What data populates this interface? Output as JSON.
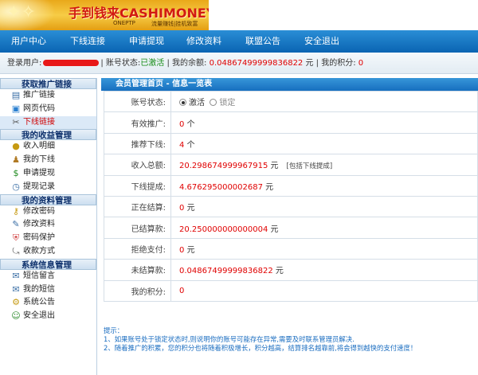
{
  "banner": {
    "title": "手到钱来CASHIMONEY!",
    "subtitle_left": "ONEPTP",
    "subtitle_right": "流量赚钱|挂机致富"
  },
  "nav": {
    "items": [
      "用户中心",
      "下线连接",
      "申请提现",
      "修改资料",
      "联盟公告",
      "安全退出"
    ]
  },
  "userbar": {
    "login_label": "登录用户:",
    "status_label": "| 账号状态:",
    "status_value": "已激活",
    "balance_label": "| 我的余额:",
    "balance_value": "0.04867499999836822",
    "balance_unit": "元",
    "points_label": "| 我的积分:",
    "points_value": "0"
  },
  "sidebar": {
    "groups": [
      {
        "title": "获取推广链接",
        "items": [
          "推广链接",
          "网页代码",
          "下线链接"
        ]
      },
      {
        "title": "我的收益管理",
        "items": [
          "收入明细",
          "我的下线",
          "申请提现",
          "提现记录"
        ]
      },
      {
        "title": "我的资料管理",
        "items": [
          "修改密码",
          "修改资料",
          "密码保护",
          "收款方式"
        ]
      },
      {
        "title": "系统信息管理",
        "items": [
          "短信留言",
          "我的短信",
          "系统公告",
          "安全退出"
        ]
      }
    ],
    "active_item": "下线链接"
  },
  "main": {
    "header": "会员管理首页 - 信息一览表",
    "rows": {
      "status": {
        "label": "账号状态:",
        "option_on": "激活",
        "option_off": "锁定"
      },
      "active_referrals": {
        "label": "有效推广:",
        "value": "0",
        "unit": "个"
      },
      "referral_downlines": {
        "label": "推荐下线:",
        "value": "4",
        "unit": "个"
      },
      "total_income": {
        "label": "收入总额:",
        "value": "20.298674999967915",
        "unit": "元",
        "note": "[包括下线提成]"
      },
      "downline_commission": {
        "label": "下线提成:",
        "value": "4.676295000002687",
        "unit": "元"
      },
      "settling": {
        "label": "正在结算:",
        "value": "0",
        "unit": "元"
      },
      "settled": {
        "label": "已结算款:",
        "value": "20.250000000000004",
        "unit": "元"
      },
      "rejected": {
        "label": "拒绝支付:",
        "value": "0",
        "unit": "元"
      },
      "unsettled": {
        "label": "未结算款:",
        "value": "0.04867499999836822",
        "unit": "元"
      },
      "my_points": {
        "label": "我的积分:",
        "value": "0"
      }
    }
  },
  "tips": {
    "title": "提示：",
    "line1": "1、如果账号处于锁定状态时,则说明你的账号可能存在异常,需要及时联系管理员解决.",
    "line2": "2、随着推广的积累，您的积分也将随着积极增长，积分越高，结算排名越靠前,将会得到越快的支付速度！"
  },
  "colors": {
    "nav_blue": "#0a64b2",
    "value_red": "#e00000",
    "status_green": "#138a13",
    "tip_blue": "#1a6dc0"
  }
}
